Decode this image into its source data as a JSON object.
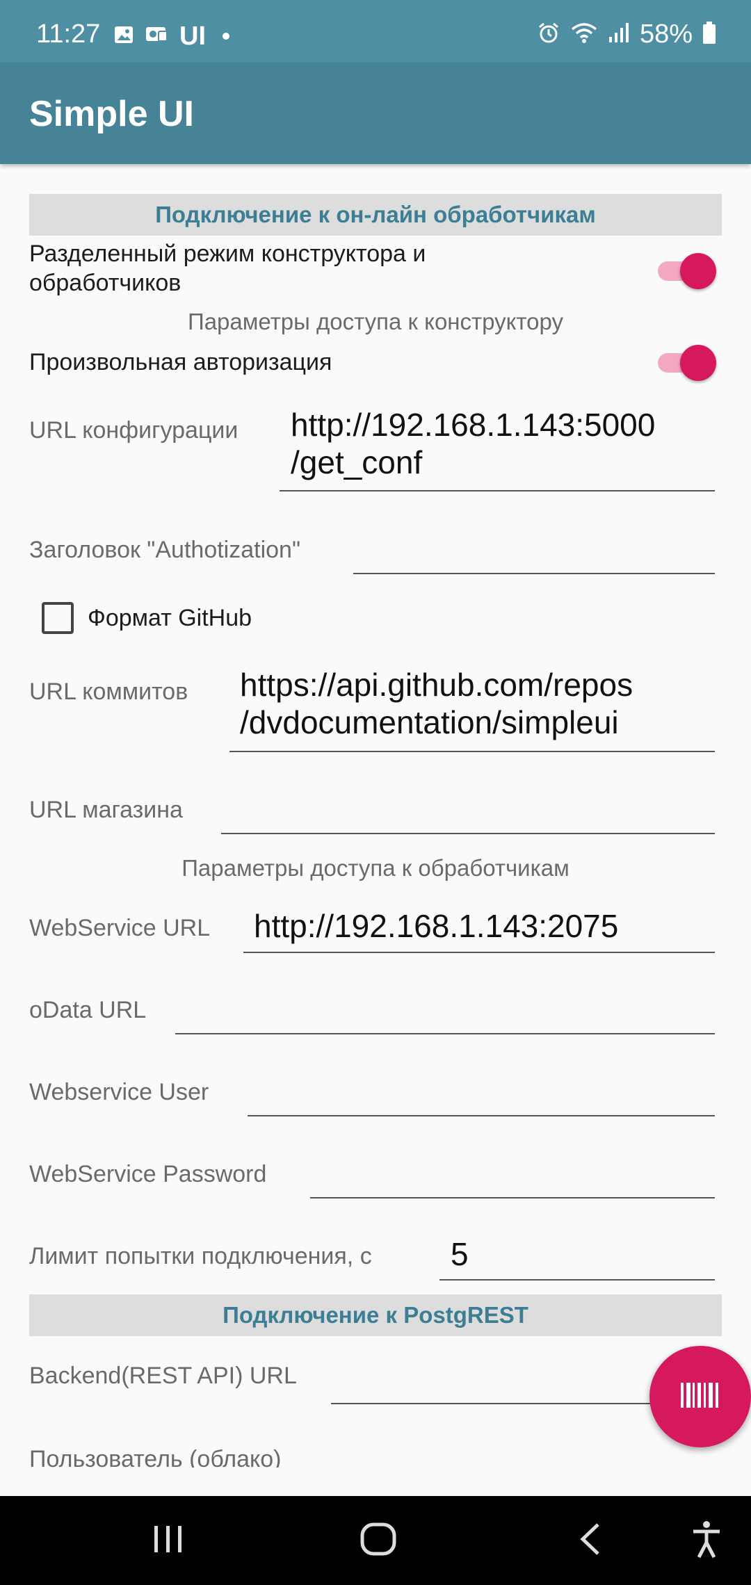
{
  "status_bar": {
    "time": "11:27",
    "app_indicator": "UI",
    "battery": "58%",
    "icons": [
      "gallery-icon",
      "cast-icon",
      "alarm-icon",
      "wifi-icon",
      "signal-icon",
      "battery-icon"
    ]
  },
  "app_bar": {
    "title": "Simple UI"
  },
  "section_online": {
    "title": "Подключение к он-лайн обработчикам"
  },
  "split_mode": {
    "label": "Разделенный режим конструктора и обработчиков",
    "label_line1": "Разделенный режим конструктора и",
    "label_line2": "обработчиков",
    "enabled": true
  },
  "constructor_params": {
    "title": "Параметры доступа к конструктору"
  },
  "custom_auth": {
    "label": "Произвольная авторизация",
    "enabled": true
  },
  "config_url": {
    "label": "URL конфигурации",
    "value_line1": "http://192.168.1.143:5000",
    "value_line2": "/get_conf"
  },
  "auth_header": {
    "label": "Заголовок \"Authotization\"",
    "value": ""
  },
  "github_format": {
    "label": "Формат GitHub",
    "checked": false
  },
  "commits_url": {
    "label": "URL коммитов",
    "value_line1": "https://api.github.com/repos",
    "value_line2": "/dvdocumentation/simpleui"
  },
  "store_url": {
    "label": "URL магазина",
    "value": ""
  },
  "handlers_params": {
    "title": "Параметры доступа к обработчикам"
  },
  "webservice_url": {
    "label": "WebService URL",
    "value": "http://192.168.1.143:2075"
  },
  "odata_url": {
    "label": "oData URL",
    "value": ""
  },
  "webservice_user": {
    "label": "Webservice User",
    "value": ""
  },
  "webservice_password": {
    "label": "WebService Password",
    "value": ""
  },
  "timeout": {
    "label": "Лимит попытки подключения, с",
    "value": "5"
  },
  "section_postgrest": {
    "title": "Подключение к PostgREST"
  },
  "backend_url": {
    "label": "Backend(REST API) URL",
    "value": ""
  },
  "cloud_user": {
    "label": "Пользователь (облако)"
  },
  "colors": {
    "status_bar": "#4f8fa3",
    "app_bar": "#468396",
    "accent": "#d6195e",
    "section_text": "#3c7e93",
    "section_bg": "#dddddd"
  },
  "fab": {
    "icon": "barcode-icon"
  },
  "nav_bar": {
    "icons": [
      "recents-icon",
      "home-icon",
      "back-icon",
      "accessibility-icon"
    ]
  }
}
